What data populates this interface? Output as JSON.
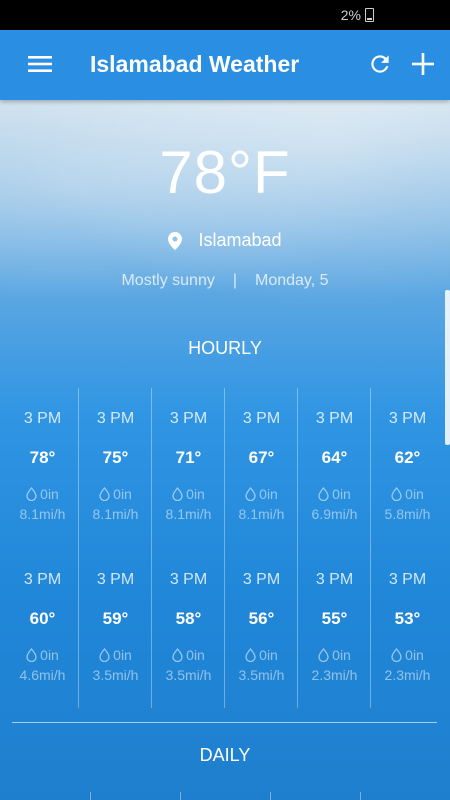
{
  "status_bar": {
    "battery_text": "2%"
  },
  "app_bar": {
    "title": "Islamabad Weather",
    "icons": [
      "menu-icon",
      "refresh-icon",
      "add-icon"
    ]
  },
  "current": {
    "temperature": "78°F",
    "location": "Islamabad",
    "condition": "Mostly sunny",
    "separator": "|",
    "date": "Monday, 5"
  },
  "hourly": {
    "title": "HOURLY",
    "rows": [
      [
        {
          "time": "3 PM",
          "temp": "78°",
          "precip": "0in",
          "wind": "8.1mi/h"
        },
        {
          "time": "3 PM",
          "temp": "75°",
          "precip": "0in",
          "wind": "8.1mi/h"
        },
        {
          "time": "3 PM",
          "temp": "71°",
          "precip": "0in",
          "wind": "8.1mi/h"
        },
        {
          "time": "3 PM",
          "temp": "67°",
          "precip": "0in",
          "wind": "8.1mi/h"
        },
        {
          "time": "3 PM",
          "temp": "64°",
          "precip": "0in",
          "wind": "6.9mi/h"
        },
        {
          "time": "3 PM",
          "temp": "62°",
          "precip": "0in",
          "wind": "5.8mi/h"
        }
      ],
      [
        {
          "time": "3 PM",
          "temp": "60°",
          "precip": "0in",
          "wind": "4.6mi/h"
        },
        {
          "time": "3 PM",
          "temp": "59°",
          "precip": "0in",
          "wind": "3.5mi/h"
        },
        {
          "time": "3 PM",
          "temp": "58°",
          "precip": "0in",
          "wind": "3.5mi/h"
        },
        {
          "time": "3 PM",
          "temp": "56°",
          "precip": "0in",
          "wind": "3.5mi/h"
        },
        {
          "time": "3 PM",
          "temp": "55°",
          "precip": "0in",
          "wind": "2.3mi/h"
        },
        {
          "time": "3 PM",
          "temp": "53°",
          "precip": "0in",
          "wind": "2.3mi/h"
        }
      ]
    ]
  },
  "daily": {
    "title": "DAILY"
  },
  "colors": {
    "app_bar": "#2a8fe3",
    "status_bar": "#000000",
    "text": "#ffffff"
  }
}
